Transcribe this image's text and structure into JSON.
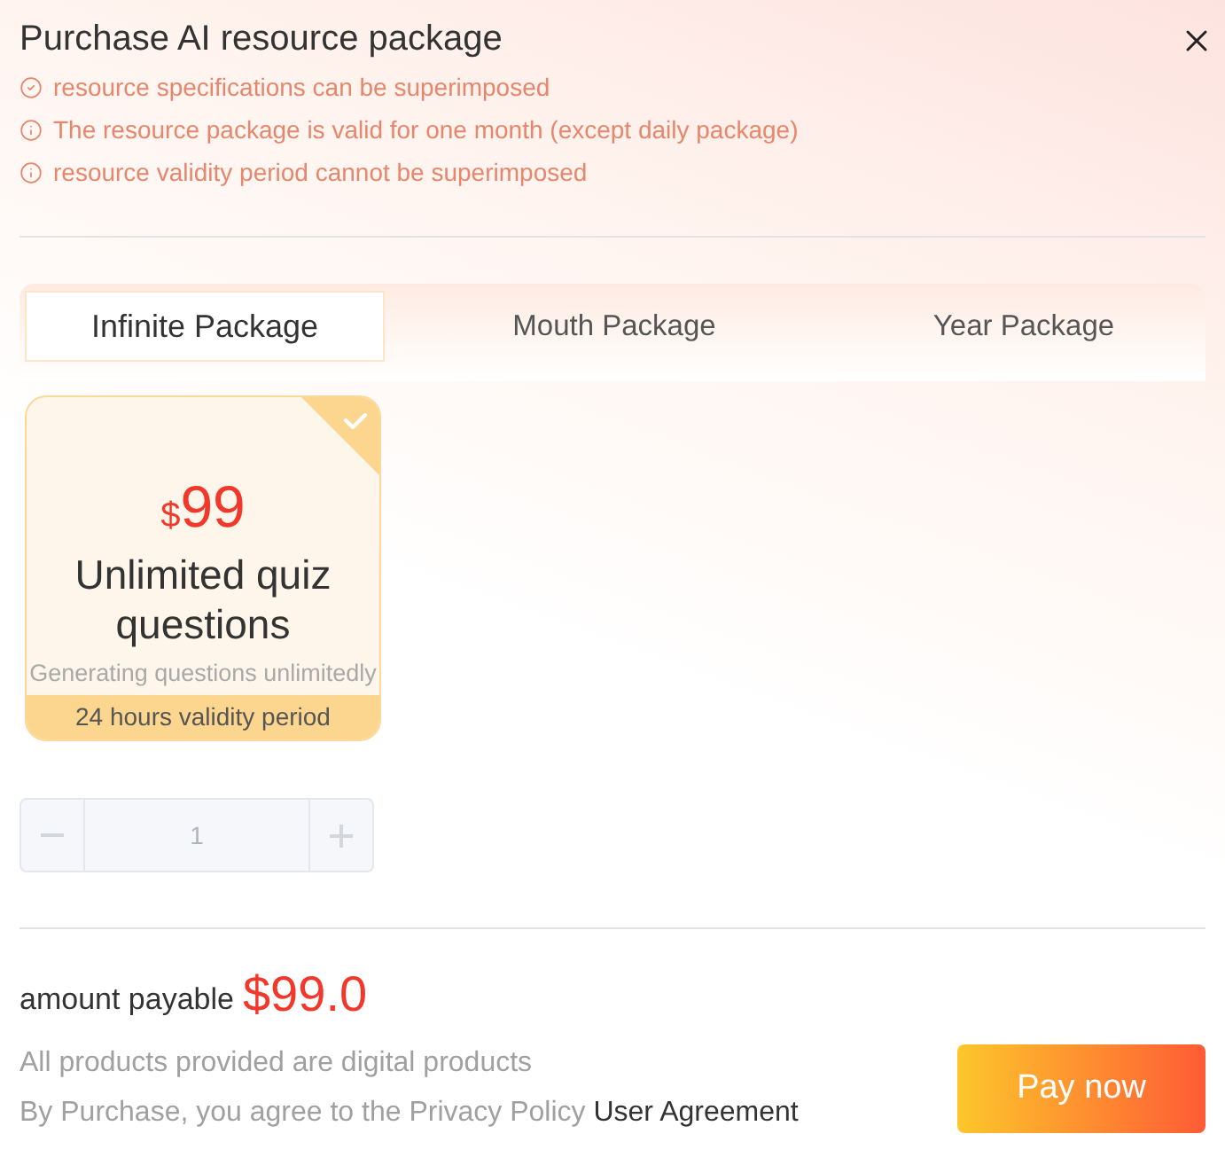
{
  "dialog": {
    "title": "Purchase AI resource package"
  },
  "notes": [
    {
      "kind": "check",
      "text": "resource specifications can be superimposed"
    },
    {
      "kind": "info",
      "text": "The resource package is valid for one month (except daily package)"
    },
    {
      "kind": "info",
      "text": "resource validity period cannot be superimposed"
    }
  ],
  "tabs": [
    {
      "label": "Infinite Package",
      "selected": true
    },
    {
      "label": "Mouth Package",
      "selected": false
    },
    {
      "label": "Year Package",
      "selected": false
    }
  ],
  "packages": [
    {
      "currency": "$",
      "price": "99",
      "title": "Unlimited quiz questions",
      "description": "Generating questions unlimitedly",
      "validity": "24 hours validity period",
      "selected": true
    }
  ],
  "quantity": {
    "value": "1",
    "disabled": true
  },
  "summary": {
    "label": "amount payable",
    "amount": "$99.0"
  },
  "footer": {
    "note": "All products provided are digital products",
    "agreement_text": "By Purchase, you agree to the Privacy Policy",
    "agreement_link": "User Agreement",
    "pay_button": "Pay now"
  }
}
